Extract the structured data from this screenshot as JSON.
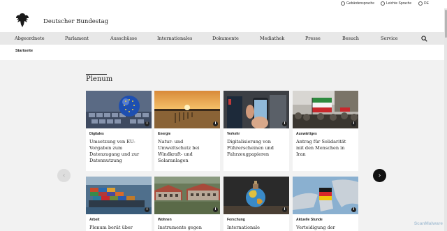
{
  "utility": {
    "sign_language": "Gebärdensprache",
    "easy_language": "Leichte Sprache",
    "language": "DE"
  },
  "header": {
    "title": "Deutscher Bundestag"
  },
  "nav": [
    "Abgeordnete",
    "Parlament",
    "Ausschüsse",
    "Internationales",
    "Dokumente",
    "Mediathek",
    "Presse",
    "Besuch",
    "Service"
  ],
  "breadcrumb": "Startseite",
  "section": {
    "title": "Plenum"
  },
  "cards": [
    {
      "category": "Digitales",
      "title": "Umsetzung von EU-Vorgaben zum Datenzugang und zur Datennutzung",
      "image": "eu-keyboard"
    },
    {
      "category": "Energie",
      "title": "Natur- und Umweltschutz bei Windkraft- und Solaranlagen",
      "image": "sunset-lake"
    },
    {
      "category": "Verkehr",
      "title": "Digitalisierung von Führerscheinen und Fahrzeugpapieren",
      "image": "smartphone"
    },
    {
      "category": "Auswärtiges",
      "title": "Antrag für Solidarität mit den Menschen in Iran",
      "image": "iran-protest"
    },
    {
      "category": "Arbeit",
      "title": "Plenum berät über Vorlagen",
      "image": "container-ship"
    },
    {
      "category": "Wohnen",
      "title": "Instrumente gegen",
      "image": "housing"
    },
    {
      "category": "Forschung",
      "title": "Internationale Kooperation",
      "image": "globe"
    },
    {
      "category": "Aktuelle Stunde",
      "title": "Verteidigung der",
      "image": "europe-map"
    }
  ],
  "info_glyph": "i",
  "arrows": {
    "prev": "‹",
    "next": "›"
  },
  "watermark": "ScanMalware"
}
